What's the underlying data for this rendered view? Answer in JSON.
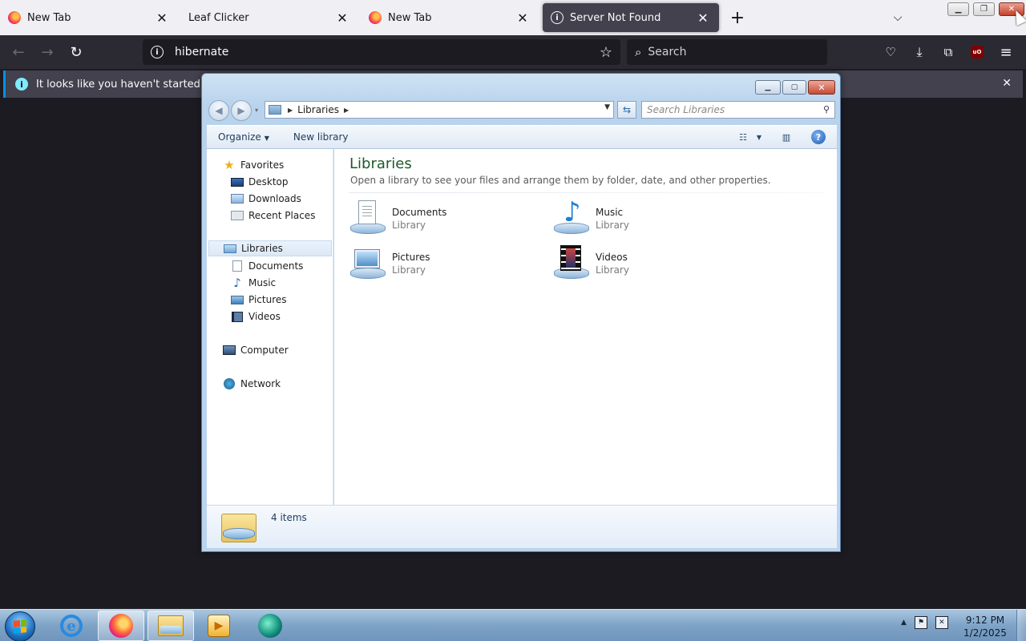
{
  "browser": {
    "tabs": [
      {
        "title": "New Tab",
        "icon": "firefox-icon",
        "active": false
      },
      {
        "title": "Leaf Clicker",
        "icon": "",
        "active": false
      },
      {
        "title": "New Tab",
        "icon": "firefox-icon",
        "active": false
      },
      {
        "title": "Server Not Found",
        "icon": "info-icon",
        "active": true
      }
    ],
    "url": "hibernate",
    "search_placeholder": "Search",
    "notification": "It looks like you haven't started Firefox i"
  },
  "explorer": {
    "breadcrumb": "Libraries",
    "search_placeholder": "Search Libraries",
    "commands": {
      "organize": "Organize",
      "new_library": "New library"
    },
    "nav": {
      "favorites": "Favorites",
      "desktop": "Desktop",
      "downloads": "Downloads",
      "recent_places": "Recent Places",
      "libraries": "Libraries",
      "documents": "Documents",
      "music": "Music",
      "pictures": "Pictures",
      "videos": "Videos",
      "computer": "Computer",
      "network": "Network"
    },
    "content": {
      "title": "Libraries",
      "subtitle": "Open a library to see your files and arrange them by folder, date, and other properties.",
      "items": [
        {
          "name": "Documents",
          "type": "Library",
          "icon": "documents-library-icon"
        },
        {
          "name": "Music",
          "type": "Library",
          "icon": "music-library-icon"
        },
        {
          "name": "Pictures",
          "type": "Library",
          "icon": "pictures-library-icon"
        },
        {
          "name": "Videos",
          "type": "Library",
          "icon": "videos-library-icon"
        }
      ]
    },
    "status": "4 items"
  },
  "taskbar": {
    "time": "9:12 PM",
    "date": "1/2/2025"
  },
  "colors": {
    "browser_bg": "#1c1b22",
    "active_tab": "#42414d",
    "notif_accent": "#0090ed",
    "library_title": "#1e5a2a"
  }
}
